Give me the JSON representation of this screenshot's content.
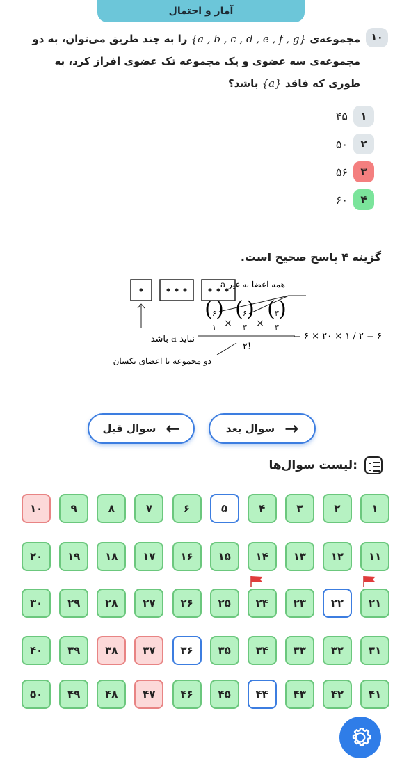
{
  "header": {
    "title": "آمار و احتمال"
  },
  "question": {
    "number": "۱۰",
    "text_before": "مجموعه‌ی",
    "set": "{a , b , c , d , e , f , g}",
    "text_after": "را به چند طریق می‌توان، به دو مجموعه‌ی سه عضوی و یک مجموعه تک عضوی افراز کرد، به طوری که فاقد",
    "set_a": "{a}",
    "text_end": "باشد؟"
  },
  "options": [
    {
      "label": "۱",
      "value": "۴۵",
      "state": "neutral"
    },
    {
      "label": "۲",
      "value": "۵۰",
      "state": "neutral"
    },
    {
      "label": "۳",
      "value": "۵۶",
      "state": "wrong"
    },
    {
      "label": "۴",
      "value": "۶۰",
      "state": "right"
    }
  ],
  "answer": {
    "title": "گزینه ۴ پاسخ صحیح است.",
    "note_top": "همه اعضا به غیر a",
    "note_left": "نباید a باشد",
    "note_bottom": "دو مجموعه با اعضای یکسان",
    "denominator": "۲!",
    "calc": "= ۶ × ۲۰ × ۱ / ۲ = ۶۰"
  },
  "nav": {
    "next_label": "سوال بعد",
    "prev_label": "سوال قبل"
  },
  "list": {
    "title": "لیست سوال‌ها:",
    "items": [
      "۱",
      "۲",
      "۳",
      "۴",
      "۵",
      "۶",
      "۷",
      "۸",
      "۹",
      "۱۰",
      "۱۱",
      "۱۲",
      "۱۳",
      "۱۴",
      "۱۵",
      "۱۶",
      "۱۷",
      "۱۸",
      "۱۹",
      "۲۰",
      "۲۱",
      "۲۲",
      "۲۳",
      "۲۴",
      "۲۵",
      "۲۶",
      "۲۷",
      "۲۸",
      "۲۹",
      "۳۰",
      "۳۱",
      "۳۲",
      "۳۳",
      "۳۴",
      "۳۵",
      "۳۶",
      "۳۷",
      "۳۸",
      "۳۹",
      "۴۰",
      "۴۱",
      "۴۲",
      "۴۳",
      "۴۴",
      "۴۵",
      "۴۶",
      "۴۷",
      "۴۸",
      "۴۹",
      "۵۰"
    ],
    "wrong": [
      10,
      37,
      38,
      47
    ],
    "blank": [
      5,
      22,
      36,
      44
    ],
    "flagged": [
      21,
      24
    ]
  },
  "colors": {
    "accent": "#3c7de0",
    "header": "#6cc6d9",
    "correct": "#b6f2c2",
    "wrong": "#fcd9d9"
  }
}
